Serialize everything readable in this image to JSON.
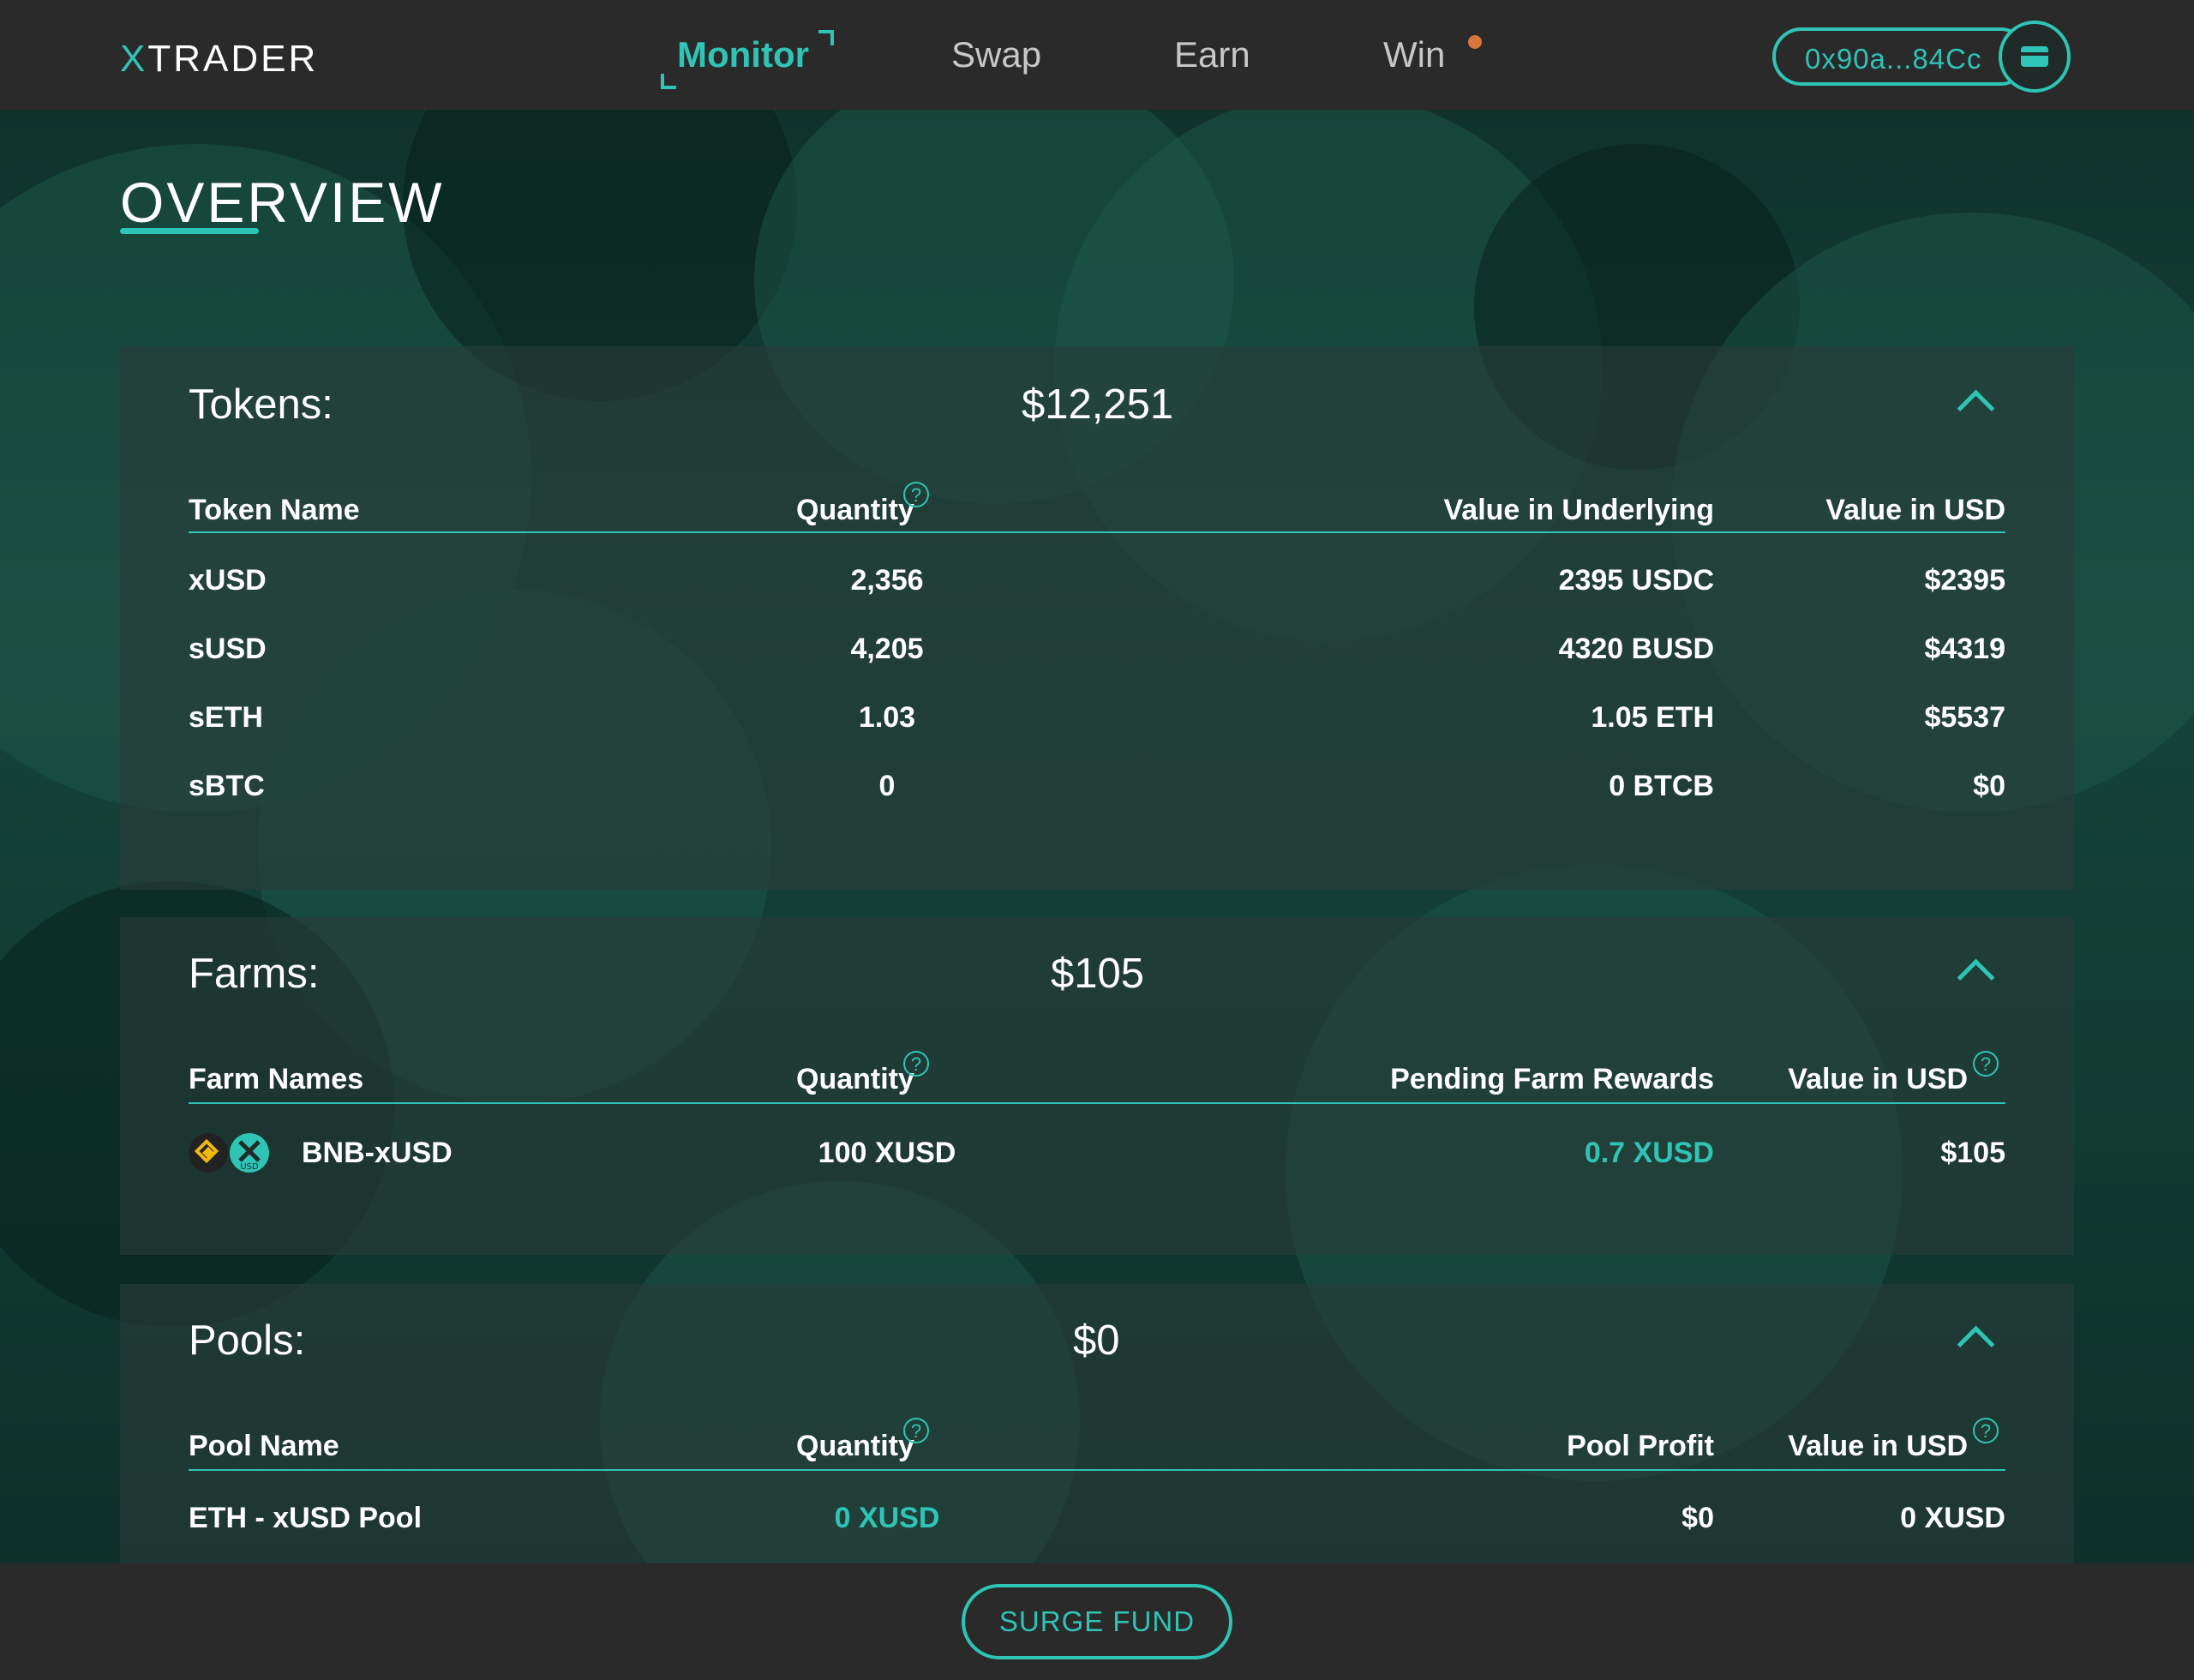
{
  "brand": {
    "logo_x": "X",
    "logo_rest": "TRADER",
    "accent_color": "#2ec4b6"
  },
  "nav": {
    "items": [
      {
        "label": "Monitor",
        "active": true
      },
      {
        "label": "Swap",
        "active": false
      },
      {
        "label": "Earn",
        "active": false
      },
      {
        "label": "Win",
        "active": false,
        "notification_dot": true
      }
    ]
  },
  "wallet": {
    "address": "0x90a...84Cc",
    "icon": "wallet-card-icon"
  },
  "page": {
    "title": "OVERVIEW"
  },
  "tokens": {
    "title": "Tokens:",
    "total": "$12,251",
    "headers": [
      "Token Name",
      "Quantity",
      "Value in Underlying",
      "Value in USD"
    ],
    "rows": [
      {
        "name": "xUSD",
        "quantity": "2,356",
        "underlying": "2395 USDC",
        "usd": "$2395"
      },
      {
        "name": "sUSD",
        "quantity": "4,205",
        "underlying": "4320 BUSD",
        "usd": "$4319"
      },
      {
        "name": "sETH",
        "quantity": "1.03",
        "underlying": "1.05 ETH",
        "usd": "$5537"
      },
      {
        "name": "sBTC",
        "quantity": "0",
        "underlying": "0 BTCB",
        "usd": "$0"
      }
    ]
  },
  "farms": {
    "title": "Farms:",
    "total": "$105",
    "headers": [
      "Farm Names",
      "Quantity",
      "Pending Farm Rewards",
      "Value in USD"
    ],
    "rows": [
      {
        "name": "BNB-xUSD",
        "quantity": "100 XUSD",
        "rewards": "0.7 XUSD",
        "usd": "$105",
        "icon_small_text": "USD"
      }
    ]
  },
  "pools": {
    "title": "Pools:",
    "total": "$0",
    "headers": [
      "Pool Name",
      "Quantity",
      "Pool Profit",
      "Value in USD"
    ],
    "rows": [
      {
        "name": "ETH - xUSD Pool",
        "quantity": "0 XUSD",
        "profit": "$0",
        "usd": "0 XUSD"
      }
    ]
  },
  "help_glyph": "?",
  "footer": {
    "button": "SURGE FUND"
  }
}
